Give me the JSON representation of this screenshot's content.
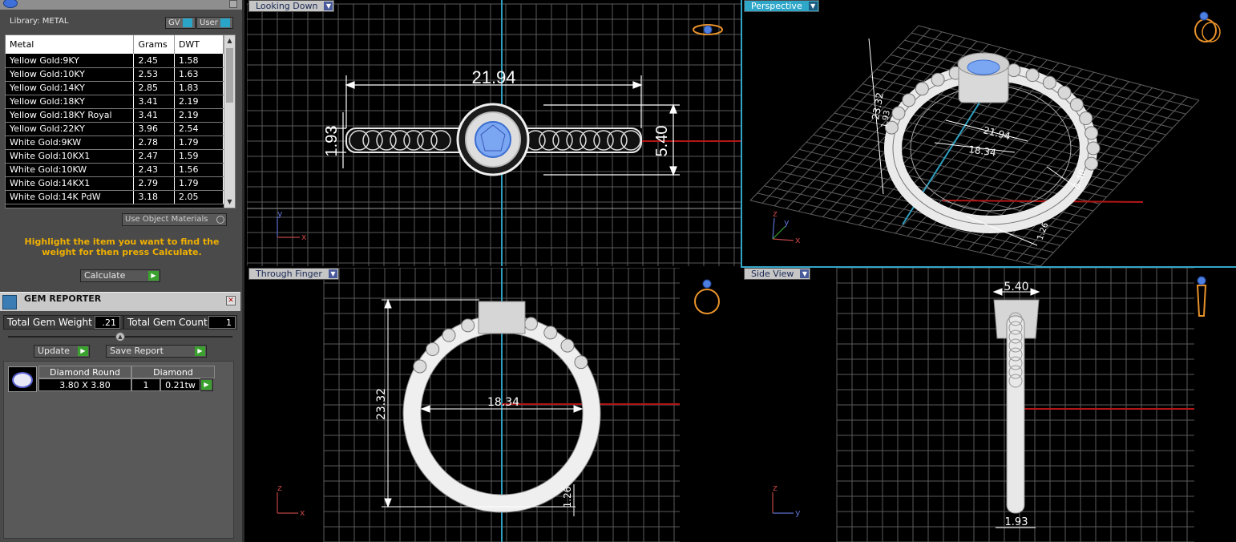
{
  "library": {
    "title": "Library: METAL",
    "chip_gv": "GV",
    "chip_user": "User",
    "columns": [
      "Metal",
      "Grams",
      "DWT"
    ],
    "rows": [
      [
        "Yellow Gold:9KY",
        "2.45",
        "1.58"
      ],
      [
        "Yellow Gold:10KY",
        "2.53",
        "1.63"
      ],
      [
        "Yellow Gold:14KY",
        "2.85",
        "1.83"
      ],
      [
        "Yellow Gold:18KY",
        "3.41",
        "2.19"
      ],
      [
        "Yellow Gold:18KY Royal",
        "3.41",
        "2.19"
      ],
      [
        "Yellow Gold:22KY",
        "3.96",
        "2.54"
      ],
      [
        "White Gold:9KW",
        "2.78",
        "1.79"
      ],
      [
        "White Gold:10KX1",
        "2.47",
        "1.59"
      ],
      [
        "White Gold:10KW",
        "2.43",
        "1.56"
      ],
      [
        "White Gold:14KX1",
        "2.79",
        "1.79"
      ],
      [
        "White Gold:14K PdW",
        "3.18",
        "2.05"
      ]
    ],
    "use_object_materials": "Use Object Materials",
    "hint": "Highlight the item you want to find the weight for then press Calculate.",
    "calculate": "Calculate"
  },
  "gem_reporter": {
    "title": "GEM REPORTER",
    "total_weight_label": "Total Gem Weight",
    "total_weight_value": ".21",
    "total_count_label": "Total Gem Count",
    "total_count_value": "1",
    "update": "Update",
    "save_report": "Save Report",
    "gem_shape": "Diamond Round",
    "gem_material": "Diamond",
    "gem_size": "3.80 X 3.80",
    "gem_qty": "1",
    "gem_weight": "0.21tw"
  },
  "viewports": {
    "top_left": {
      "label": "Looking Down",
      "dims": [
        "21.94",
        "1.93",
        "5.40"
      ],
      "axis": [
        "y",
        "x"
      ]
    },
    "top_right": {
      "label": "Perspective",
      "dims": [
        "23.32",
        "21.94",
        "18.34",
        "5.40",
        "1.93",
        "1.26"
      ],
      "axis": [
        "z",
        "y",
        "x"
      ]
    },
    "bottom_left": {
      "label": "Through Finger",
      "dims": [
        "23.32",
        "18.34",
        "1.26"
      ],
      "axis": [
        "z",
        "x"
      ]
    },
    "bottom_right": {
      "label": "Side View",
      "dims": [
        "5.40",
        "1.93"
      ],
      "axis": [
        "z",
        "y"
      ]
    }
  },
  "icons": {
    "gem_icon": "diamond-ring-icon",
    "orient_icon": "ring-orientation-icon"
  },
  "colors": {
    "grid": "#6a6a6a",
    "axis_teal": "#2f9fbf",
    "axis_red": "#b21616",
    "accent_orange": "#f0b000",
    "go_green": "#3aa12f",
    "viewport_active": "#2ea7c8"
  }
}
